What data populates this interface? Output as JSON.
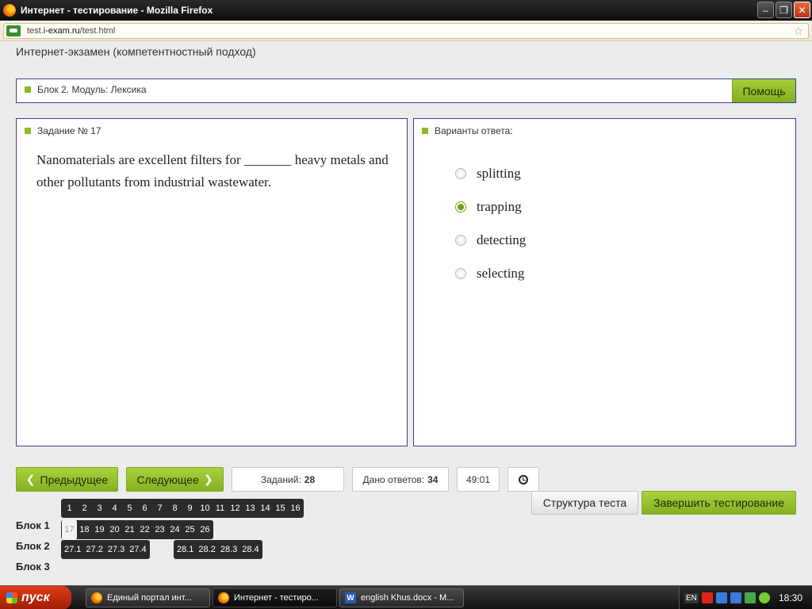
{
  "window": {
    "title": "Интернет - тестирование - Mozilla Firefox"
  },
  "address": {
    "url_prefix": "test.",
    "url_domain": "i-exam.ru",
    "url_path": "/test.html"
  },
  "page": {
    "title": "Интернет-экзамен (компетентностный подход)"
  },
  "block_bar": {
    "label": "Блок 2. Модуль: Лексика",
    "help_label": "Помощь"
  },
  "task": {
    "header": "Задание № 17",
    "question": "Nanomaterials are excellent filters for _______ heavy metals and other pollutants from industrial wastewater."
  },
  "answers": {
    "header": "Варианты ответа:",
    "options": [
      {
        "label": "splitting",
        "checked": false
      },
      {
        "label": "trapping",
        "checked": true
      },
      {
        "label": "detecting",
        "checked": false
      },
      {
        "label": "selecting",
        "checked": false
      }
    ]
  },
  "nav": {
    "prev_label": "Предыдущее",
    "next_label": "Следующее",
    "tasks_label": "Заданий:",
    "tasks_value": "28",
    "answers_label": "Дано ответов:",
    "answers_value": "34",
    "timer": "49:01",
    "structure_label": "Структура теста",
    "finish_label": "Завершить тестирование"
  },
  "blocks": {
    "labels": [
      "Блок 1",
      "Блок 2",
      "Блок 3"
    ],
    "row1": [
      "1",
      "2",
      "3",
      "4",
      "5",
      "6",
      "7",
      "8",
      "9",
      "10",
      "11",
      "12",
      "13",
      "14",
      "15",
      "16"
    ],
    "row2": [
      "17",
      "18",
      "19",
      "20",
      "21",
      "22",
      "23",
      "24",
      "25",
      "26"
    ],
    "current": "17",
    "row3a": [
      "27.1",
      "27.2",
      "27.3",
      "27.4"
    ],
    "row3b": [
      "28.1",
      "28.2",
      "28.3",
      "28.4"
    ]
  },
  "taskbar": {
    "start_label": "пуск",
    "tasks": [
      "Единый портал инт...",
      "Интернет - тестиро...",
      "english Khus.docx - M..."
    ],
    "lang": "EN",
    "time": "18:30"
  }
}
